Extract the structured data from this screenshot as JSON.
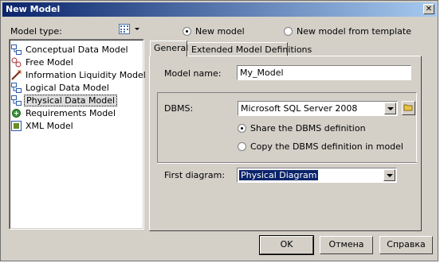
{
  "window": {
    "title": "New Model",
    "close_glyph": "✕"
  },
  "model_type": {
    "label": "Model type:",
    "items": [
      {
        "label": "Conceptual Data Model",
        "icon": "conceptual-model-icon"
      },
      {
        "label": "Free Model",
        "icon": "free-model-icon"
      },
      {
        "label": "Information Liquidity Model",
        "icon": "information-liquidity-icon"
      },
      {
        "label": "Logical Data Model",
        "icon": "logical-model-icon"
      },
      {
        "label": "Physical Data Model",
        "icon": "physical-model-icon"
      },
      {
        "label": "Requirements Model",
        "icon": "requirements-model-icon"
      },
      {
        "label": "XML Model",
        "icon": "xml-model-icon"
      }
    ],
    "selected": "Physical Data Model"
  },
  "mode": {
    "new_model": "New model",
    "from_template": "New model from template",
    "selected": "new_model"
  },
  "tabs": [
    {
      "label": "General"
    },
    {
      "label": "Extended Model Definitions"
    }
  ],
  "general": {
    "model_name_label": "Model name:",
    "model_name_value": "My_Model",
    "dbms_label": "DBMS:",
    "dbms_value": "Microsoft SQL Server 2008",
    "share_label": "Share the DBMS definition",
    "copy_label": "Copy the DBMS definition in model",
    "dbms_option_selected": "share",
    "first_diagram_label": "First diagram:",
    "first_diagram_value": "Physical Diagram"
  },
  "buttons": {
    "ok": "OK",
    "cancel": "Отмена",
    "help": "Справка"
  },
  "colors": {
    "title_start": "#0a246a",
    "title_end": "#a6caf0",
    "face": "#d4d0c8",
    "selection": "#0a246a"
  }
}
